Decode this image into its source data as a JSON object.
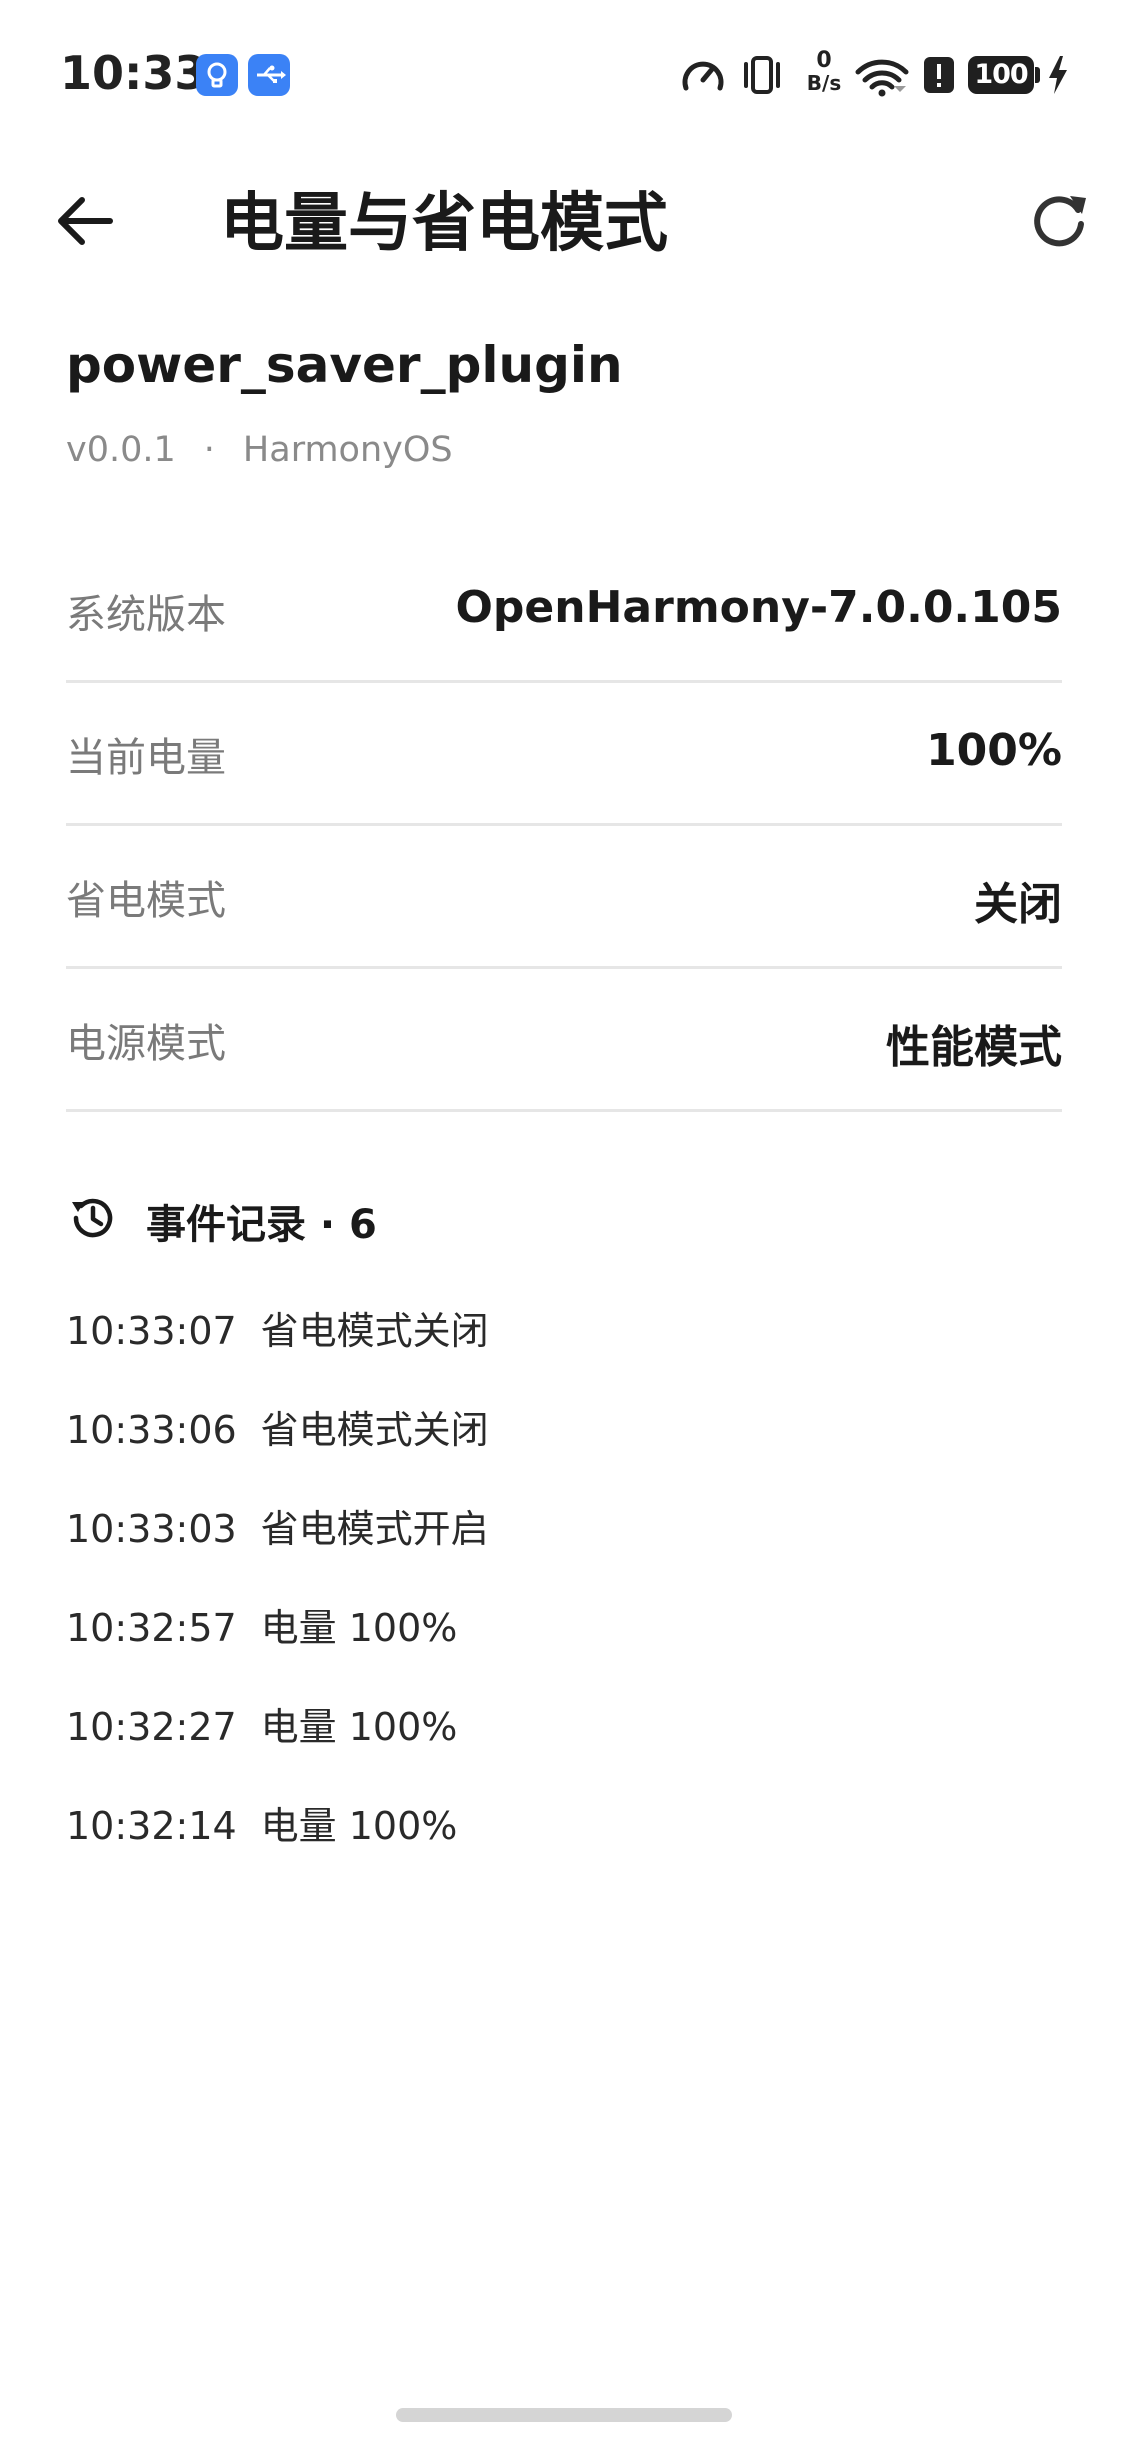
{
  "status_bar": {
    "time": "10:33",
    "battery_level": "100",
    "network_speed_value": "0",
    "network_speed_unit": "B/s",
    "notification_icons": [
      "lightbulb-icon",
      "usb-icon"
    ],
    "system_icons": [
      "speedometer-icon",
      "vibrate-icon",
      "network-speed-icon",
      "wifi-icon",
      "alert-icon",
      "battery-icon",
      "charging-icon"
    ]
  },
  "app_bar": {
    "title": "电量与省电模式",
    "back_icon": "arrow-left-icon",
    "refresh_icon": "refresh-icon"
  },
  "plugin": {
    "name": "power_saver_plugin",
    "version": "v0.0.1",
    "separator": "·",
    "platform": "HarmonyOS"
  },
  "info_rows": [
    {
      "label": "系统版本",
      "value": "OpenHarmony-7.0.0.105"
    },
    {
      "label": "当前电量",
      "value": "100%"
    },
    {
      "label": "省电模式",
      "value": "关闭"
    },
    {
      "label": "电源模式",
      "value": "性能模式"
    }
  ],
  "events": {
    "title": "事件记录 · 6",
    "icon": "history-icon",
    "items": [
      {
        "time": "10:33:07",
        "text": "省电模式关闭"
      },
      {
        "time": "10:33:06",
        "text": "省电模式关闭"
      },
      {
        "time": "10:33:03",
        "text": "省电模式开启"
      },
      {
        "time": "10:32:57",
        "text": "电量 100%"
      },
      {
        "time": "10:32:27",
        "text": "电量 100%"
      },
      {
        "time": "10:32:14",
        "text": "电量 100%"
      }
    ]
  },
  "colors": {
    "notification_blue": "#3b82f6",
    "divider": "#e6e6e6",
    "label_gray": "#7a7a7a"
  }
}
